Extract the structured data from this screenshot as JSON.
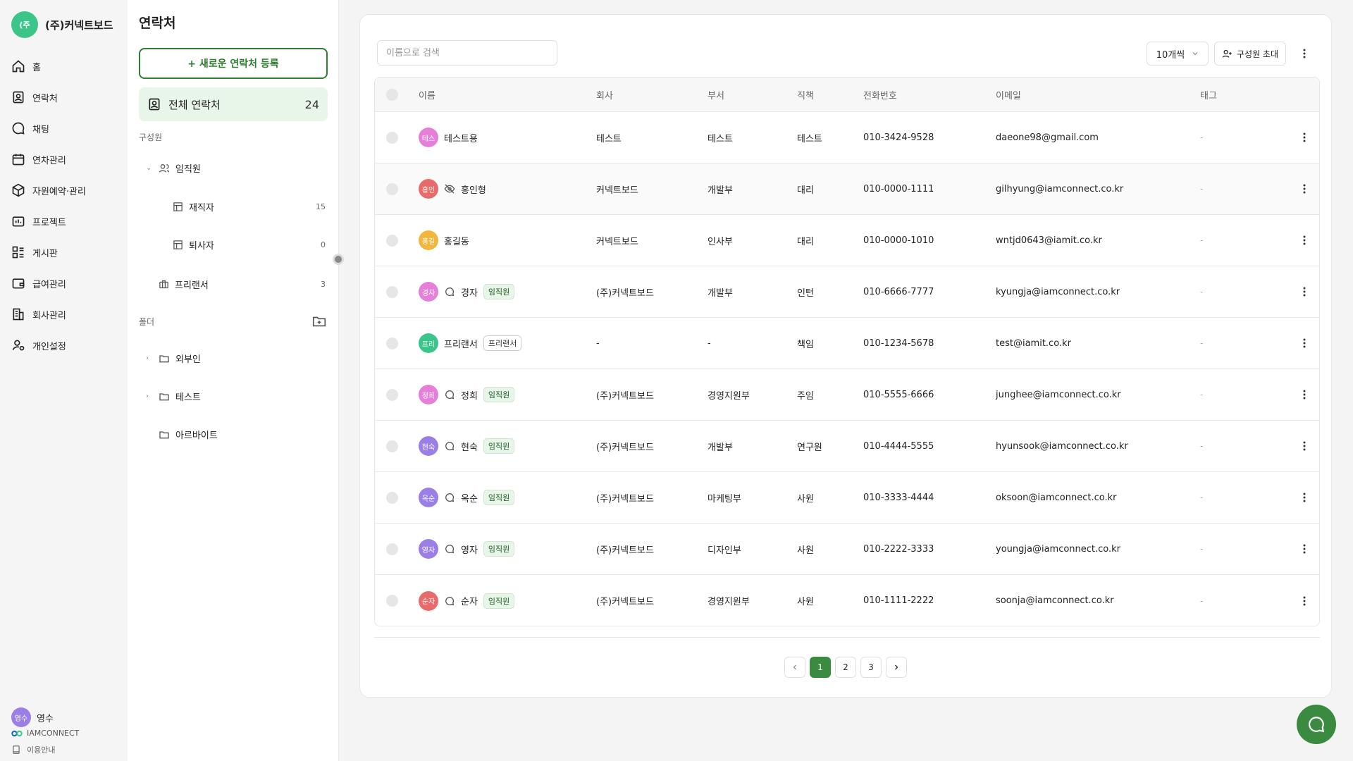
{
  "brand": {
    "logo_text": "(주",
    "name": "(주)커넥트보드"
  },
  "nav": {
    "items": [
      {
        "label": "홈",
        "icon": "home-icon"
      },
      {
        "label": "연락처",
        "icon": "contact-icon"
      },
      {
        "label": "채팅",
        "icon": "chat-icon"
      },
      {
        "label": "연차관리",
        "icon": "calendar-icon"
      },
      {
        "label": "자원예약·관리",
        "icon": "box-icon"
      },
      {
        "label": "프로젝트",
        "icon": "project-icon"
      },
      {
        "label": "게시판",
        "icon": "board-icon"
      },
      {
        "label": "급여관리",
        "icon": "wallet-icon"
      },
      {
        "label": "회사관리",
        "icon": "building-icon"
      },
      {
        "label": "개인설정",
        "icon": "user-settings-icon"
      }
    ],
    "user": {
      "avatar": "영수",
      "name": "영수"
    },
    "company_brand": "IAMCONNECT",
    "guide": "이용안내"
  },
  "side": {
    "title": "연락처",
    "new_button": "+ 새로운 연락처 등록",
    "all_contacts": {
      "label": "전체 연락처",
      "count": "24"
    },
    "members_label": "구성원",
    "employees": "임직원",
    "active": {
      "label": "재직자",
      "count": "15"
    },
    "retired": {
      "label": "퇴사자",
      "count": "0"
    },
    "freelancer": {
      "label": "프리랜서",
      "count": "3"
    },
    "folder_label": "폴더",
    "folders": [
      "외부인",
      "테스트",
      "아르바이트"
    ]
  },
  "toolbar": {
    "search_placeholder": "이름으로 검색",
    "per_page": "10개씩",
    "invite": "구성원 초대"
  },
  "table": {
    "headers": {
      "name": "이름",
      "company": "회사",
      "dept": "부서",
      "title": "직책",
      "phone": "전화번호",
      "email": "이메일",
      "tag": "태그"
    },
    "rows": [
      {
        "avatar": "테스",
        "avatar_color": "#e57fd7",
        "icon": "",
        "name": "테스트용",
        "badge": "",
        "company": "테스트",
        "dept": "테스트",
        "title": "테스트",
        "phone": "010-3424-9528",
        "email": "daeone98@gmail.com",
        "tag": "-"
      },
      {
        "avatar": "홍인",
        "avatar_color": "#e86a6a",
        "icon": "eye-off-icon",
        "name": "홍인형",
        "badge": "",
        "company": "커넥트보드",
        "dept": "개발부",
        "title": "대리",
        "phone": "010-0000-1111",
        "email": "gilhyung@iamconnect.co.kr",
        "tag": "-"
      },
      {
        "avatar": "홍길",
        "avatar_color": "#f2b63c",
        "icon": "",
        "name": "홍길동",
        "badge": "",
        "company": "커넥트보드",
        "dept": "인사부",
        "title": "대리",
        "phone": "010-0000-1010",
        "email": "wntjd0643@iamit.co.kr",
        "tag": "-"
      },
      {
        "avatar": "경자",
        "avatar_color": "#e57fd7",
        "icon": "chat-bubble-icon",
        "name": "경자",
        "badge": "임직원",
        "badge_type": "emp",
        "company": "(주)커넥트보드",
        "dept": "개발부",
        "title": "인턴",
        "phone": "010-6666-7777",
        "email": "kyungja@iamconnect.co.kr",
        "tag": "-"
      },
      {
        "avatar": "프리",
        "avatar_color": "#3cc58a",
        "icon": "",
        "name": "프리랜서",
        "badge": "프리랜서",
        "badge_type": "free",
        "company": "-",
        "dept": "-",
        "title": "책임",
        "phone": "010-1234-5678",
        "email": "test@iamit.co.kr",
        "tag": "-"
      },
      {
        "avatar": "정희",
        "avatar_color": "#e57fd7",
        "icon": "chat-bubble-icon",
        "name": "정희",
        "badge": "임직원",
        "badge_type": "emp",
        "company": "(주)커넥트보드",
        "dept": "경영지원부",
        "title": "주임",
        "phone": "010-5555-6666",
        "email": "junghee@iamconnect.co.kr",
        "tag": "-"
      },
      {
        "avatar": "현숙",
        "avatar_color": "#9b7fe6",
        "icon": "chat-bubble-icon",
        "name": "현숙",
        "badge": "임직원",
        "badge_type": "emp",
        "company": "(주)커넥트보드",
        "dept": "개발부",
        "title": "연구원",
        "phone": "010-4444-5555",
        "email": "hyunsook@iamconnect.co.kr",
        "tag": "-"
      },
      {
        "avatar": "옥순",
        "avatar_color": "#9b7fe6",
        "icon": "chat-bubble-icon",
        "name": "옥순",
        "badge": "임직원",
        "badge_type": "emp",
        "company": "(주)커넥트보드",
        "dept": "마케팅부",
        "title": "사원",
        "phone": "010-3333-4444",
        "email": "oksoon@iamconnect.co.kr",
        "tag": "-"
      },
      {
        "avatar": "영자",
        "avatar_color": "#9b7fe6",
        "icon": "chat-bubble-icon",
        "name": "영자",
        "badge": "임직원",
        "badge_type": "emp",
        "company": "(주)커넥트보드",
        "dept": "디자인부",
        "title": "사원",
        "phone": "010-2222-3333",
        "email": "youngja@iamconnect.co.kr",
        "tag": "-"
      },
      {
        "avatar": "순자",
        "avatar_color": "#e86a6a",
        "icon": "chat-bubble-icon",
        "name": "순자",
        "badge": "임직원",
        "badge_type": "emp",
        "company": "(주)커넥트보드",
        "dept": "경영지원부",
        "title": "사원",
        "phone": "010-1111-2222",
        "email": "soonja@iamconnect.co.kr",
        "tag": "-"
      }
    ]
  },
  "pagination": {
    "pages": [
      "1",
      "2",
      "3"
    ],
    "current": "1"
  },
  "colors": {
    "brand_green": "#3a8a3f",
    "logo_green": "#3cc58a"
  }
}
